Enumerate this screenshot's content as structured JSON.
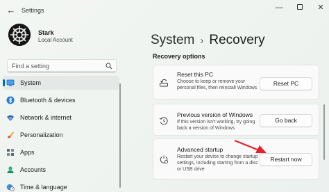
{
  "window": {
    "title": "Settings",
    "back_icon": "back-arrow-icon",
    "controls": {
      "minimize": "—",
      "maximize": "",
      "close": "✕"
    }
  },
  "profile": {
    "name": "Stark",
    "account_type": "Local Account"
  },
  "search": {
    "placeholder": "Find a setting"
  },
  "sidebar": {
    "items": [
      {
        "label": "System",
        "icon": "monitor-icon",
        "active": true
      },
      {
        "label": "Bluetooth & devices",
        "icon": "bluetooth-icon"
      },
      {
        "label": "Network & internet",
        "icon": "wifi-icon"
      },
      {
        "label": "Personalization",
        "icon": "brush-icon"
      },
      {
        "label": "Apps",
        "icon": "apps-icon"
      },
      {
        "label": "Accounts",
        "icon": "person-icon"
      },
      {
        "label": "Time & language",
        "icon": "globe-clock-icon"
      }
    ]
  },
  "main": {
    "breadcrumb": {
      "parent": "System",
      "separator": "›",
      "current": "Recovery"
    },
    "section_title": "Recovery options",
    "options": [
      {
        "title": "Reset this PC",
        "description": "Choose to keep or remove your personal files, then reinstall Windows",
        "button": "Reset PC",
        "icon": "reset-pc-icon"
      },
      {
        "title": "Previous version of Windows",
        "description": "If this version isn't working, try going back a version of Windows",
        "button": "Go back",
        "icon": "history-icon"
      },
      {
        "title": "Advanced startup",
        "description": "Restart your device to change startup settings, including starting from a disc or USB drive",
        "button": "Restart now",
        "icon": "advanced-startup-icon"
      }
    ]
  },
  "colors": {
    "accent": "#0067c0",
    "annotation_arrow": "#e8202a"
  }
}
